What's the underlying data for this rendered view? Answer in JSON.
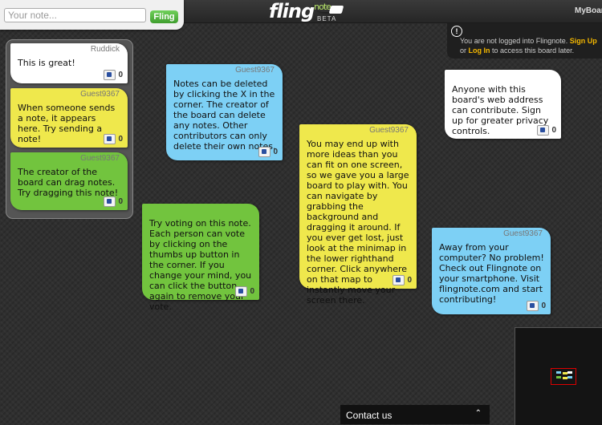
{
  "header": {
    "input_placeholder": "Your note...",
    "fling_label": "Fling",
    "logo_main": "fling",
    "logo_accent": "note",
    "logo_beta": "BETA",
    "myboard_label": "MyBoar"
  },
  "login_notice": {
    "icon": "info-icon",
    "text_before": "You are not logged into Flingnote.",
    "signup_label": "Sign Up",
    "or": "or",
    "login_label": "Log In",
    "text_after": "to access this board later."
  },
  "notes": [
    {
      "author": "Ruddick",
      "text": "This is great!",
      "votes": "0",
      "color": "#ffffff"
    },
    {
      "author": "Guest9367",
      "text": "When someone sends a note, it appears here. Try sending a note!",
      "votes": "0",
      "color": "#efe84c"
    },
    {
      "author": "Guest9367",
      "text": "The creator of the board can drag notes. Try dragging this note!",
      "votes": "0",
      "color": "#72c43e"
    },
    {
      "author": "Guest9367",
      "text": "Notes can be deleted by clicking the X in the corner. The creator of the board can delete any notes. Other contributors can only delete their own notes.",
      "votes": "0",
      "color": "#7dd0f5"
    },
    {
      "author": "Guest9367",
      "text": "You may end up with more ideas than you can fit on one screen, so we gave you a large board to play with. You can navigate by grabbing the background and dragging it around. If you ever get lost, just look at the minimap in the lower righthand corner. Click anywhere on that map to instantly move your screen there.",
      "votes": "0",
      "color": "#efe84c"
    },
    {
      "author": "",
      "text": "Anyone with this board's web address can contribute. Sign up for greater privacy controls.",
      "votes": "0",
      "color": "#ffffff"
    },
    {
      "author": "",
      "text": "Try voting on this note. Each person can vote by clicking on the thumbs up button in the corner. If you change your mind, you can click the button again to remove your vote.",
      "votes": "0",
      "color": "#72c43e"
    },
    {
      "author": "Guest9367",
      "text": "Away from your computer? No problem! Check out Flingnote on your smartphone. Visit flingnote.com and start contributing!",
      "votes": "0",
      "color": "#7dd0f5"
    }
  ],
  "footer": {
    "contact_label": "Contact us",
    "chevron": "chevron-up-icon"
  }
}
